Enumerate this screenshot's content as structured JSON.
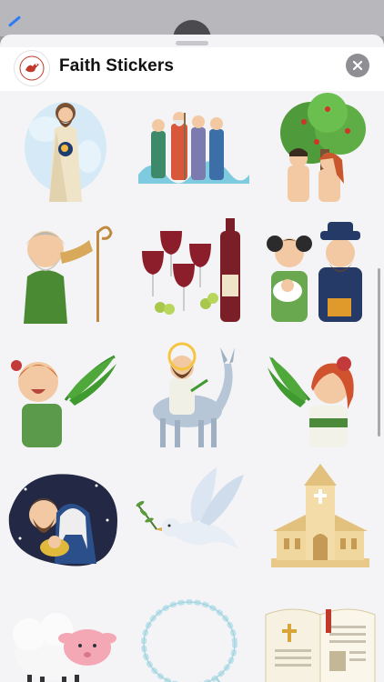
{
  "app": {
    "title": "Faith Stickers",
    "icon": "dove-logo-icon",
    "close_icon": "close-icon"
  },
  "colors": {
    "sheet_background": "#f4f4f6",
    "header_background": "#ffffff",
    "close_button": "#8e8e93"
  },
  "stickers": [
    {
      "name": "jesus-sticker"
    },
    {
      "name": "prophets-group-sticker"
    },
    {
      "name": "adam-eve-tree-sticker"
    },
    {
      "name": "shepherd-horn-sticker"
    },
    {
      "name": "wine-glasses-sticker"
    },
    {
      "name": "family-baby-sticker"
    },
    {
      "name": "boy-palm-sticker"
    },
    {
      "name": "jesus-donkey-sticker"
    },
    {
      "name": "girl-palm-sticker"
    },
    {
      "name": "holy-family-night-sticker"
    },
    {
      "name": "dove-olive-sticker"
    },
    {
      "name": "church-sticker"
    },
    {
      "name": "lamb-sticker"
    },
    {
      "name": "rosary-sticker"
    },
    {
      "name": "open-bible-sticker"
    }
  ]
}
